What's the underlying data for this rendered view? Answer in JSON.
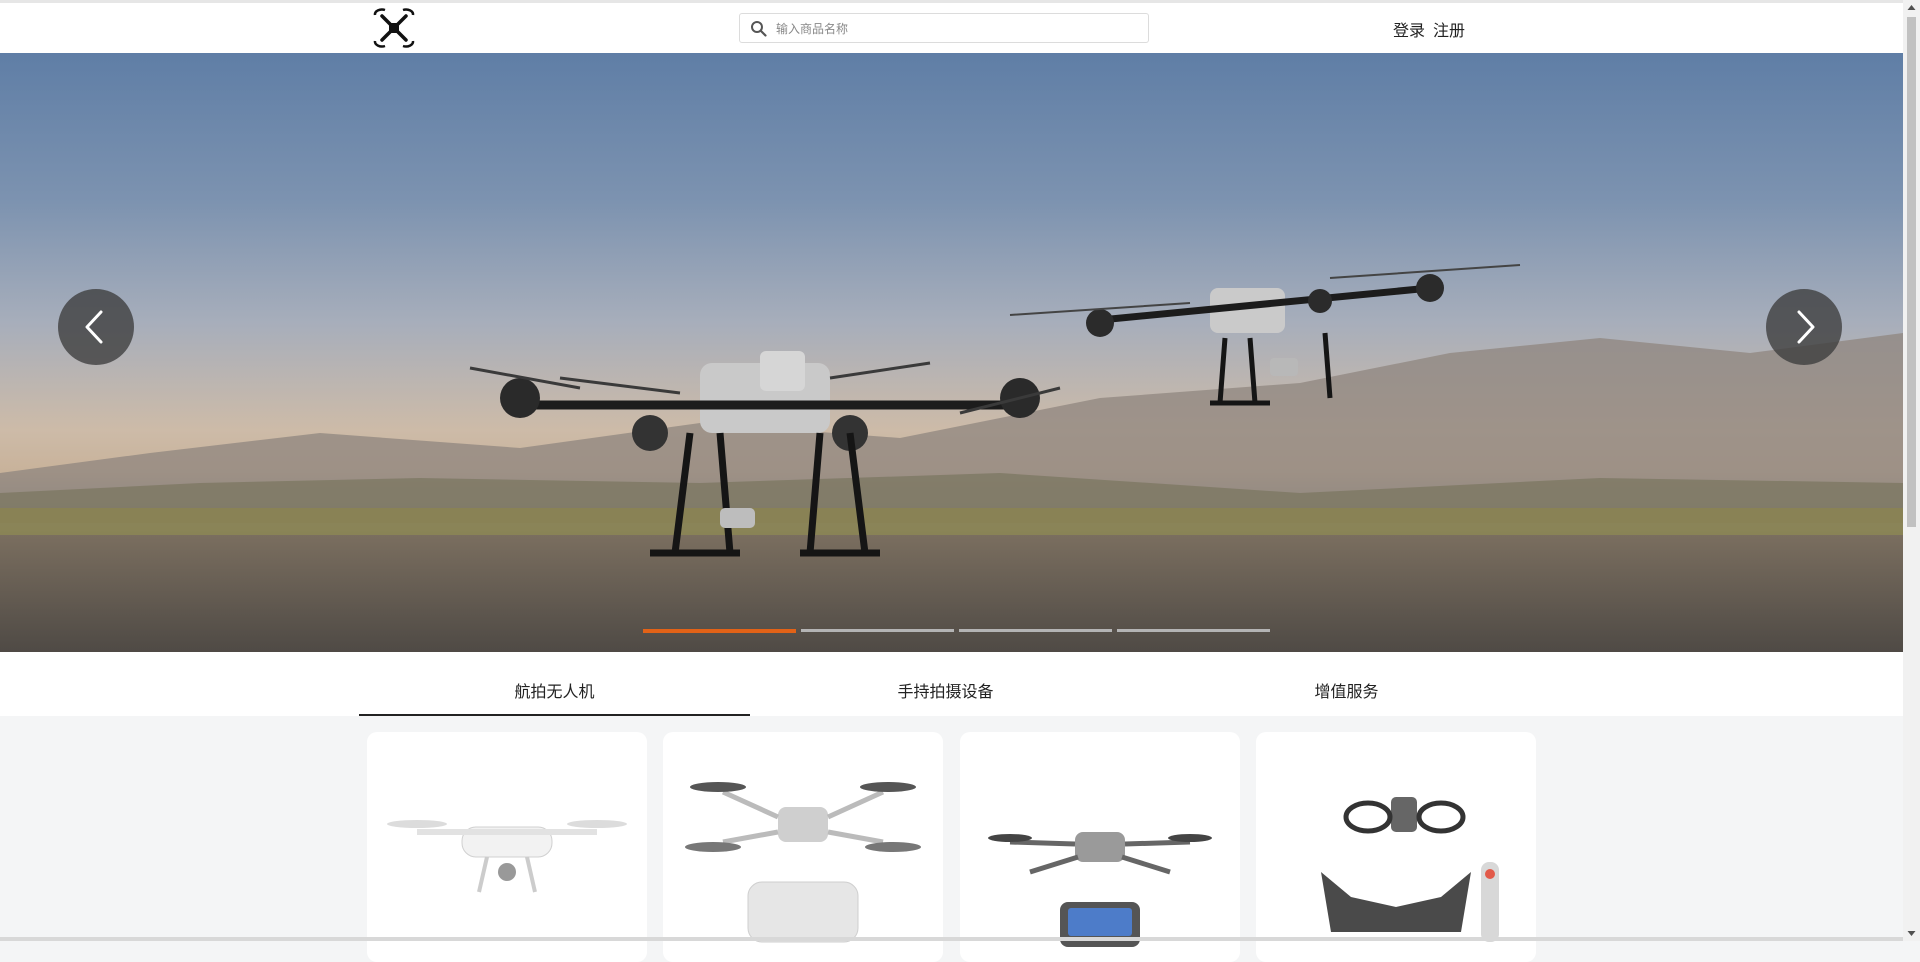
{
  "header": {
    "logo_icon": "drone-icon",
    "search": {
      "placeholder": "输入商品名称",
      "value": "",
      "icon": "search-icon"
    },
    "login_label": "登录",
    "register_label": "注册"
  },
  "carousel": {
    "slide_count": 4,
    "active_index": 0,
    "prev_icon": "chevron-left-icon",
    "next_icon": "chevron-right-icon",
    "active_color": "#e26217"
  },
  "category_tabs": [
    {
      "label": "航拍无人机",
      "active": true
    },
    {
      "label": "手持拍摄设备",
      "active": false
    },
    {
      "label": "增值服务",
      "active": false
    }
  ],
  "products": [
    {
      "image": "phantom-drone-image"
    },
    {
      "image": "mini-drone-with-controller-image"
    },
    {
      "image": "mavic-drone-with-screen-controller-image"
    },
    {
      "image": "avata-fpv-kit-image"
    }
  ]
}
